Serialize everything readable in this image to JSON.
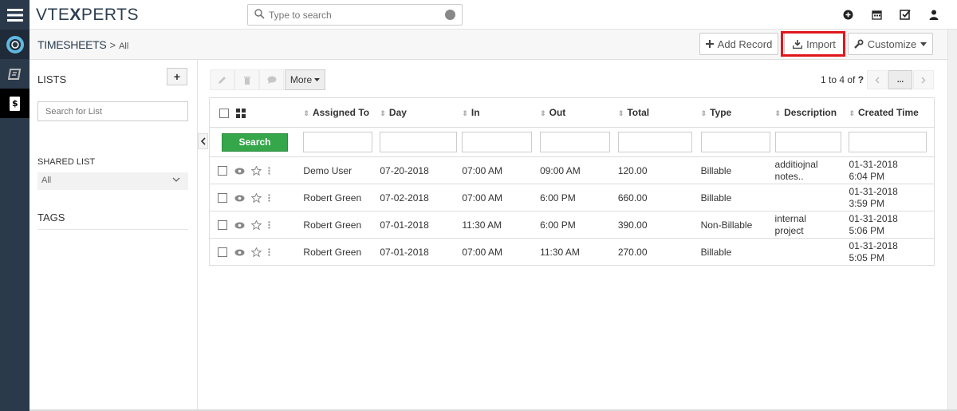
{
  "app": {
    "logo": "VTE",
    "logo_x": "X",
    "logo_rest": "PERTS"
  },
  "search": {
    "placeholder": "Type to search"
  },
  "breadcrumb": {
    "module": "TIMESHEETS",
    "separator": ">",
    "view": "All"
  },
  "header_buttons": {
    "add_record": "Add Record",
    "import": "Import",
    "customize": "Customize"
  },
  "sidebar": {
    "lists_label": "LISTS",
    "add_label": "+",
    "list_search_placeholder": "Search for List",
    "shared_list_label": "SHARED LIST",
    "shared_list_value": "All",
    "tags_label": "TAGS"
  },
  "toolbar": {
    "more_label": "More"
  },
  "pager": {
    "range": "1 to 4",
    "of": "of",
    "total": "?",
    "more": "..."
  },
  "table": {
    "columns": [
      "Assigned To",
      "Day",
      "In",
      "Out",
      "Total",
      "Type",
      "Description",
      "Created Time"
    ],
    "search_button": "Search",
    "rows": [
      {
        "assigned": "Demo User",
        "day": "07-20-2018",
        "in": "07:00 AM",
        "out": "09:00 AM",
        "total": "120.00",
        "type": "Billable",
        "desc1": "additiojnal",
        "desc2": "notes..",
        "created1": "01-31-2018",
        "created2": "6:04 PM"
      },
      {
        "assigned": "Robert Green",
        "day": "07-02-2018",
        "in": "07:00 AM",
        "out": "6:00 PM",
        "total": "660.00",
        "type": "Billable",
        "desc1": "",
        "desc2": "",
        "created1": "01-31-2018",
        "created2": "3:59 PM"
      },
      {
        "assigned": "Robert Green",
        "day": "07-01-2018",
        "in": "11:30 AM",
        "out": "6:00 PM",
        "total": "390.00",
        "type": "Non-Billable",
        "desc1": "internal",
        "desc2": "project",
        "created1": "01-31-2018",
        "created2": "5:06 PM"
      },
      {
        "assigned": "Robert Green",
        "day": "07-01-2018",
        "in": "07:00 AM",
        "out": "11:30 AM",
        "total": "270.00",
        "type": "Billable",
        "desc1": "",
        "desc2": "",
        "created1": "01-31-2018",
        "created2": "5:05 PM"
      }
    ]
  },
  "colors": {
    "rail": "#2b3a4a",
    "search_green": "#35a64a",
    "highlight_red": "#e1161d",
    "link_blue": "#2f6fc4"
  }
}
